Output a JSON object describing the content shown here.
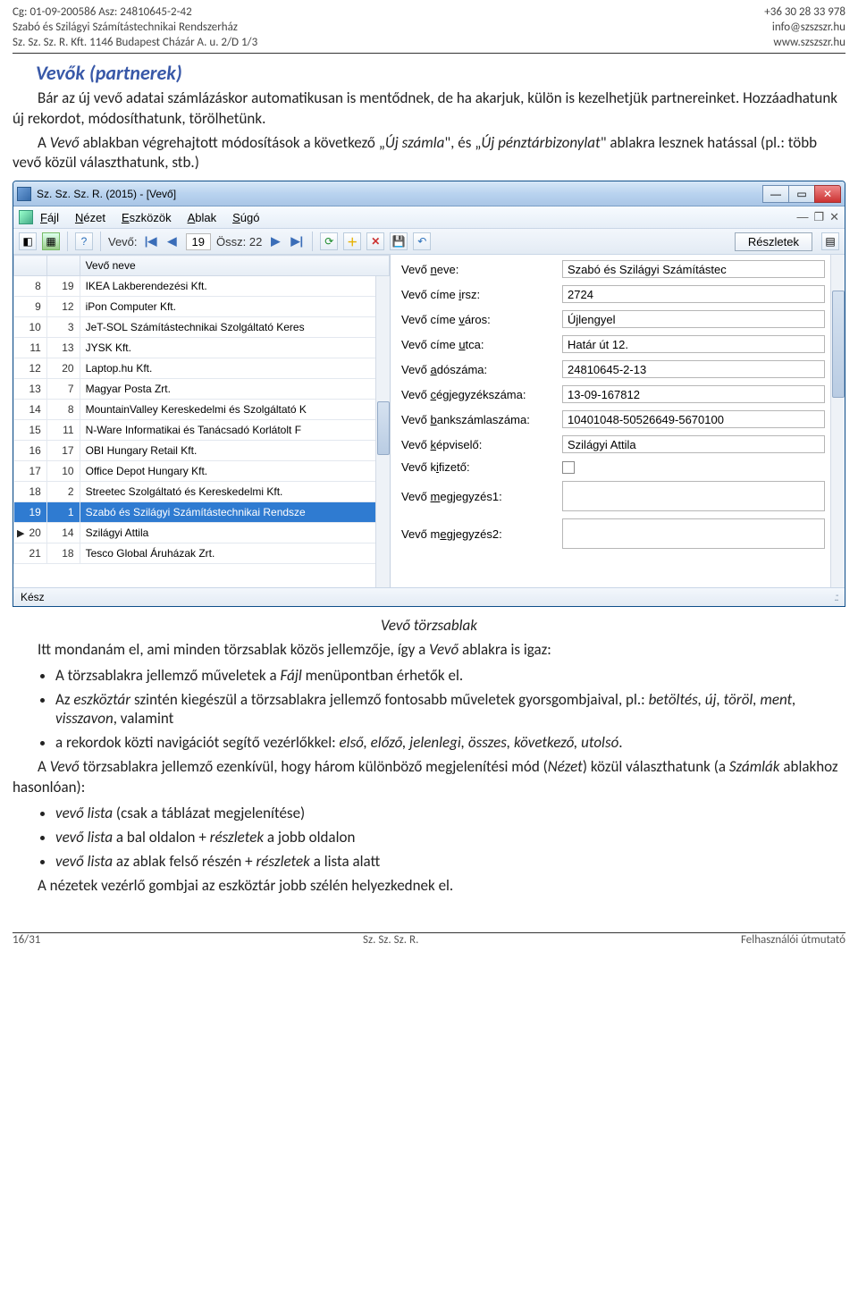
{
  "header": {
    "left1": "Cg: 01-09-200586 Asz: 24810645-2-42",
    "left2": "Szabó és Szilágyi Számítástechnikai Rendszerház",
    "left3": "Sz. Sz. Sz. R. Kft. 1146 Budapest Cházár A. u. 2/D 1/3",
    "right1": "+36 30 28 33 978",
    "right2": "info@szszszr.hu",
    "right3": "www.szszszr.hu"
  },
  "section_title": "Vevők (partnerek)",
  "para1": "Bár az új vevő adatai számlázáskor automatikusan is mentődnek, de ha akarjuk, külön is kezelhetjük partnereinket. Hozzáadhatunk új rekordot, módosíthatunk, törölhetünk.",
  "para2_pre": "A ",
  "para2_i1": "Vevő",
  "para2_mid": " ablakban végrehajtott módosítások a következő „",
  "para2_i2": "Új számla",
  "para2_mid2": "\", és „",
  "para2_i3": "Új pénztárbizonylat",
  "para2_end": "\" ablakra lesznek hatással (pl.: több vevő közül választhatunk, stb.)",
  "caption": "Vevő törzsablak",
  "para3_pre": "Itt mondanám el, ami minden törzsablak közös jellemzője, így a ",
  "para3_i": "Vevő",
  "para3_end": " ablakra is igaz:",
  "bullets": {
    "b1_pre": "A törzsablakra jellemző műveletek a ",
    "b1_i": "Fájl",
    "b1_end": " menüpontban érhetők el.",
    "b2_pre": "Az ",
    "b2_i": "eszköztár",
    "b2_mid": " szintén kiegészül a törzsablakra jellemző fontosabb műveletek gyorsgombjaival, pl.: ",
    "b2_i2": "betöltés, új, töröl, ment, visszavon",
    "b2_end": ", valamint",
    "b3_pre": "a rekordok közti navigációt segítő vezérlőkkel: ",
    "b3_i": "első, előző, jelenlegi, összes, következő, utolsó",
    "b3_end": "."
  },
  "para4_pre": "A ",
  "para4_i1": "Vevő",
  "para4_mid": " törzsablakra jellemző ezenkívül, hogy három különböző megjelenítési mód (",
  "para4_i2": "Nézet",
  "para4_mid2": ") közül választhatunk (a ",
  "para4_i3": "Számlák",
  "para4_end": " ablakhoz hasonlóan):",
  "bullets2": {
    "c1_i": "vevő lista",
    "c1_end": " (csak a táblázat megjelenítése)",
    "c2_i1": "vevő lista",
    "c2_mid": " a bal oldalon + ",
    "c2_i2": "részletek",
    "c2_end": " a jobb oldalon",
    "c3_i1": "vevő lista",
    "c3_mid": " az ablak felső részén + ",
    "c3_i2": "részletek",
    "c3_end": " a lista alatt"
  },
  "para5": "A nézetek vezérlő gombjai az eszköztár jobb szélén helyezkednek el.",
  "footer": {
    "left": "16/31",
    "mid": "Sz. Sz. Sz. R.",
    "right": "Felhasználói útmutató"
  },
  "win": {
    "title": "Sz. Sz. Sz. R. (2015) - [Vevő]",
    "menus": {
      "fajl": "Fájl",
      "nezet": "Nézet",
      "eszkozok": "Eszközök",
      "ablak": "Ablak",
      "sugo": "Súgó"
    },
    "toolbar": {
      "vevo_label": "Vevő:",
      "current": "19",
      "ossz_label": "Össz: 22",
      "details": "Részletek"
    },
    "grid": {
      "header": "Vevő neve",
      "rows": [
        {
          "a": "8",
          "b": "19",
          "name": "IKEA Lakberendezési Kft."
        },
        {
          "a": "9",
          "b": "12",
          "name": "iPon Computer Kft."
        },
        {
          "a": "10",
          "b": "3",
          "name": "JeT-SOL Számítástechnikai Szolgáltató Keres"
        },
        {
          "a": "11",
          "b": "13",
          "name": "JYSK Kft."
        },
        {
          "a": "12",
          "b": "20",
          "name": "Laptop.hu Kft."
        },
        {
          "a": "13",
          "b": "7",
          "name": "Magyar Posta Zrt."
        },
        {
          "a": "14",
          "b": "8",
          "name": "MountainValley Kereskedelmi és Szolgáltató K"
        },
        {
          "a": "15",
          "b": "11",
          "name": "N-Ware Informatikai és Tanácsadó Korlátolt F"
        },
        {
          "a": "16",
          "b": "17",
          "name": "OBI Hungary Retail Kft."
        },
        {
          "a": "17",
          "b": "10",
          "name": "Office Depot Hungary Kft."
        },
        {
          "a": "18",
          "b": "2",
          "name": "Streetec Szolgáltató és Kereskedelmi Kft."
        },
        {
          "a": "19",
          "b": "1",
          "name": "Szabó és Szilágyi Számítástechnikai Rendsze"
        },
        {
          "a": "20",
          "b": "14",
          "name": "Szilágyi Attila"
        },
        {
          "a": "21",
          "b": "18",
          "name": "Tesco Global Áruházak Zrt."
        }
      ],
      "selected_index": 11
    },
    "details": {
      "l_neve": "Vevő neve:",
      "v_neve": "Szabó és Szilágyi Számítástec",
      "l_irsz": "Vevő címe irsz:",
      "v_irsz": "2724",
      "l_varos": "Vevő címe város:",
      "v_varos": "Újlengyel",
      "l_utca": "Vevő címe utca:",
      "v_utca": "Határ út 12.",
      "l_ado": "Vevő adószáma:",
      "v_ado": "24810645-2-13",
      "l_ceg": "Vevő cégjegyzékszáma:",
      "v_ceg": "13-09-167812",
      "l_bank": "Vevő bankszámlaszáma:",
      "v_bank": "10401048-50526649-5670100",
      "l_kepv": "Vevő képviselő:",
      "v_kepv": "Szilágyi Attila",
      "l_kif": "Vevő kifizető:",
      "l_m1": "Vevő megjegyzés1:",
      "l_m2": "Vevő megjegyzés2:"
    },
    "status": "Kész"
  }
}
